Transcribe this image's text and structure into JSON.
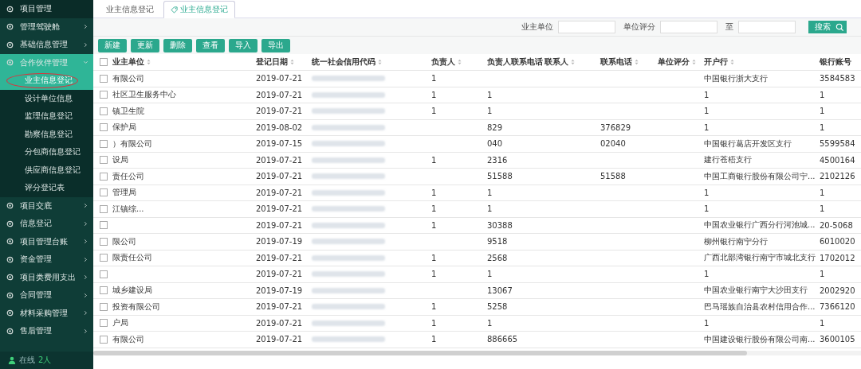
{
  "sidebar": {
    "header": "项目管理",
    "items": [
      {
        "label": "管理驾驶舱",
        "expanded": false
      },
      {
        "label": "基础信息管理",
        "expanded": false
      },
      {
        "label": "合作伙伴管理",
        "expanded": true,
        "children": [
          {
            "label": "业主信息登记",
            "selected": true,
            "circled": true
          },
          {
            "label": "设计单位信息",
            "selected": false,
            "circled": false
          },
          {
            "label": "监理信息登记",
            "selected": false,
            "circled": false
          },
          {
            "label": "勘察信息登记",
            "selected": false,
            "circled": false
          },
          {
            "label": "分包商信息登记",
            "selected": false,
            "circled": false
          },
          {
            "label": "供应商信息登记",
            "selected": false,
            "circled": false
          },
          {
            "label": "评分登记表",
            "selected": false,
            "circled": false
          }
        ]
      },
      {
        "label": "项目交底",
        "expanded": false
      },
      {
        "label": "信息登记",
        "expanded": false
      },
      {
        "label": "项目管理台账",
        "expanded": false
      },
      {
        "label": "资金管理",
        "expanded": false
      },
      {
        "label": "项目类费用支出",
        "expanded": false
      },
      {
        "label": "合同管理",
        "expanded": false
      },
      {
        "label": "材料采购管理",
        "expanded": false
      },
      {
        "label": "售后管理",
        "expanded": false
      }
    ],
    "online_label": "在线",
    "online_count": "2人"
  },
  "tabs": [
    {
      "label": "业主信息登记",
      "selected": false
    },
    {
      "label": "业主信息登记",
      "selected": true
    }
  ],
  "search": {
    "fields": [
      {
        "label": "业主单位"
      },
      {
        "label": "单位评分"
      },
      {
        "label": "至"
      }
    ],
    "button": "搜索"
  },
  "toolbar": [
    "新建",
    "更新",
    "删除",
    "查看",
    "导入",
    "导出"
  ],
  "table": {
    "all_selected": false,
    "columns": [
      "业主单位",
      "登记日期",
      "统一社会信用代码",
      "负责人",
      "负责人联系电话",
      "联系人",
      "联系电话",
      "单位评分",
      "开户行",
      "银行账号"
    ],
    "rows": [
      {
        "selected": false,
        "cells": [
          "有限公司",
          "2019-07-21",
          "",
          "1",
          "",
          "",
          "",
          "",
          "中国银行浙大支行",
          "3584583"
        ]
      },
      {
        "selected": false,
        "cells": [
          "社区卫生服务中心",
          "2019-07-21",
          "",
          "1",
          "1",
          "",
          "",
          "",
          "1",
          "1"
        ]
      },
      {
        "selected": false,
        "cells": [
          "镇卫生院",
          "2019-07-21",
          "",
          "1",
          "1",
          "",
          "",
          "",
          "1",
          "1"
        ]
      },
      {
        "selected": false,
        "cells": [
          "保护局",
          "2019-08-02",
          "",
          "",
          "829",
          "",
          "376829",
          "",
          "1",
          "1"
        ]
      },
      {
        "selected": false,
        "cells": [
          "）有限公司",
          "2019-07-15",
          "",
          "",
          "040",
          "",
          "02040",
          "",
          "中国银行葛店开发区支行",
          "5599584"
        ]
      },
      {
        "selected": false,
        "cells": [
          "设局",
          "2019-07-21",
          "",
          "1",
          "2316",
          "",
          "",
          "",
          "建行苍梧支行",
          "4500164"
        ]
      },
      {
        "selected": false,
        "cells": [
          "责任公司",
          "2019-07-21",
          "",
          "",
          "51588",
          "",
          "51588",
          "",
          "中国工商银行股份有限公司宁...",
          "2102126"
        ]
      },
      {
        "selected": false,
        "cells": [
          "管理局",
          "2019-07-21",
          "",
          "1",
          "1",
          "",
          "",
          "",
          "1",
          "1"
        ]
      },
      {
        "selected": false,
        "cells": [
          "江镇综...",
          "2019-07-21",
          "",
          "1",
          "1",
          "",
          "",
          "",
          "1",
          "1"
        ]
      },
      {
        "selected": false,
        "cells": [
          "",
          "2019-07-21",
          "",
          "1",
          "30388",
          "",
          "",
          "",
          "中国农业银行广西分行河池城...",
          "20-5068"
        ]
      },
      {
        "selected": false,
        "cells": [
          "限公司",
          "2019-07-19",
          "",
          "",
          "9518",
          "",
          "",
          "",
          "柳州银行南宁分行",
          "6010020"
        ]
      },
      {
        "selected": false,
        "cells": [
          "限责任公司",
          "2019-07-21",
          "",
          "1",
          "2568",
          "",
          "",
          "",
          "广西北部湾银行南宁市城北支行",
          "1702012"
        ]
      },
      {
        "selected": false,
        "cells": [
          "",
          "2019-07-21",
          "",
          "1",
          "1",
          "",
          "",
          "",
          "1",
          "1"
        ]
      },
      {
        "selected": false,
        "cells": [
          "城乡建设局",
          "2019-07-19",
          "",
          "",
          "13067",
          "",
          "",
          "",
          "中国农业银行南宁大沙田支行",
          "2002920"
        ]
      },
      {
        "selected": false,
        "cells": [
          "投资有限公司",
          "2019-07-21",
          "",
          "1",
          "5258",
          "",
          "",
          "",
          "巴马瑶族自治县农村信用合作...",
          "7366120"
        ]
      },
      {
        "selected": false,
        "cells": [
          "户局",
          "2019-07-21",
          "",
          "1",
          "1",
          "",
          "",
          "",
          "1",
          "1"
        ]
      },
      {
        "selected": false,
        "cells": [
          "有限公司",
          "2019-07-21",
          "",
          "1",
          "886665",
          "",
          "",
          "",
          "中国建设银行股份有限公司南...",
          "3600105"
        ]
      }
    ]
  }
}
